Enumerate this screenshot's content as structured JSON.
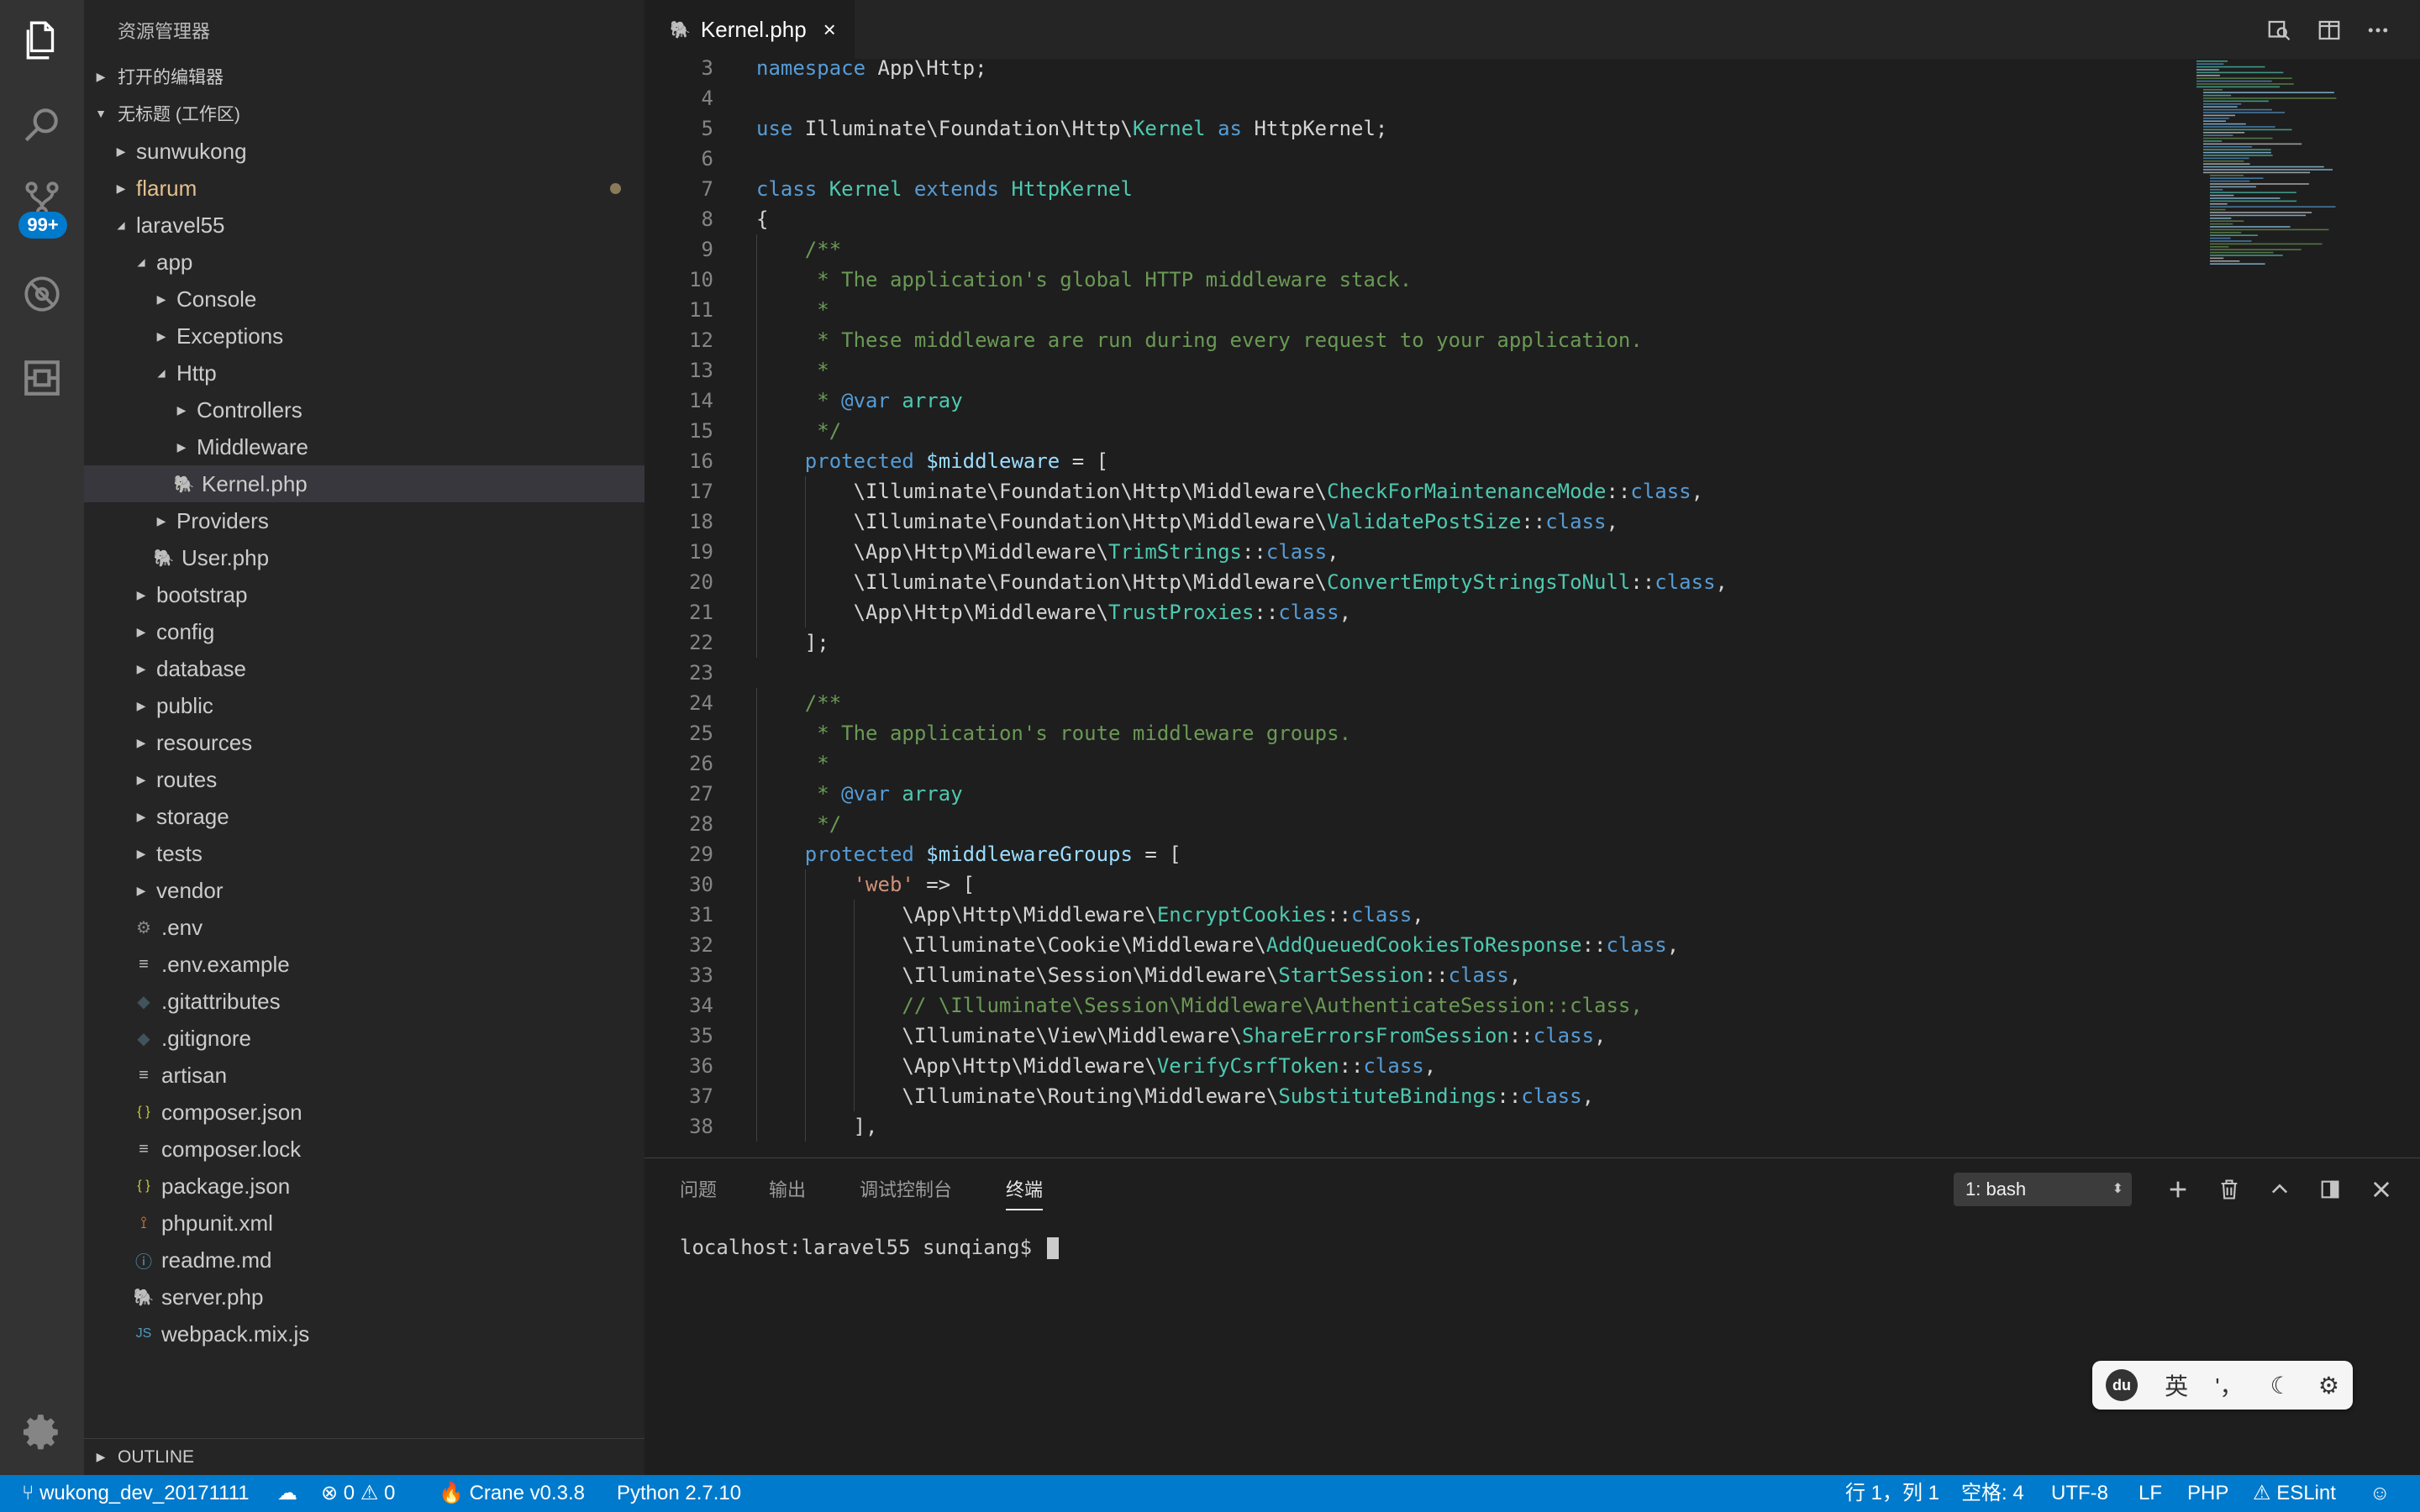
{
  "sidebar": {
    "title": "资源管理器",
    "open_editors": "打开的编辑器",
    "workspace": "无标题 (工作区)",
    "outline": "OUTLINE",
    "source_control_badge": "99+",
    "tree": [
      {
        "label": "sunwukong",
        "type": "folder",
        "level": 1,
        "expanded": false
      },
      {
        "label": "flarum",
        "type": "folder",
        "level": 1,
        "expanded": false,
        "modified": true
      },
      {
        "label": "laravel55",
        "type": "folder",
        "level": 1,
        "expanded": true
      },
      {
        "label": "app",
        "type": "folder",
        "level": 2,
        "expanded": true
      },
      {
        "label": "Console",
        "type": "folder",
        "level": 3,
        "expanded": false
      },
      {
        "label": "Exceptions",
        "type": "folder",
        "level": 3,
        "expanded": false
      },
      {
        "label": "Http",
        "type": "folder",
        "level": 3,
        "expanded": true
      },
      {
        "label": "Controllers",
        "type": "folder",
        "level": 4,
        "expanded": false
      },
      {
        "label": "Middleware",
        "type": "folder",
        "level": 4,
        "expanded": false
      },
      {
        "label": "Kernel.php",
        "type": "php",
        "level": 4,
        "selected": true
      },
      {
        "label": "Providers",
        "type": "folder",
        "level": 3,
        "expanded": false
      },
      {
        "label": "User.php",
        "type": "php",
        "level": 3
      },
      {
        "label": "bootstrap",
        "type": "folder",
        "level": 2,
        "expanded": false
      },
      {
        "label": "config",
        "type": "folder",
        "level": 2,
        "expanded": false
      },
      {
        "label": "database",
        "type": "folder",
        "level": 2,
        "expanded": false
      },
      {
        "label": "public",
        "type": "folder",
        "level": 2,
        "expanded": false
      },
      {
        "label": "resources",
        "type": "folder",
        "level": 2,
        "expanded": false
      },
      {
        "label": "routes",
        "type": "folder",
        "level": 2,
        "expanded": false
      },
      {
        "label": "storage",
        "type": "folder",
        "level": 2,
        "expanded": false
      },
      {
        "label": "tests",
        "type": "folder",
        "level": 2,
        "expanded": false
      },
      {
        "label": "vendor",
        "type": "folder",
        "level": 2,
        "expanded": false
      },
      {
        "label": ".env",
        "type": "gear",
        "level": 2
      },
      {
        "label": ".env.example",
        "type": "lines",
        "level": 2
      },
      {
        "label": ".gitattributes",
        "type": "git",
        "level": 2
      },
      {
        "label": ".gitignore",
        "type": "git",
        "level": 2
      },
      {
        "label": "artisan",
        "type": "lines",
        "level": 2
      },
      {
        "label": "composer.json",
        "type": "json",
        "level": 2
      },
      {
        "label": "composer.lock",
        "type": "lines",
        "level": 2
      },
      {
        "label": "package.json",
        "type": "json",
        "level": 2
      },
      {
        "label": "phpunit.xml",
        "type": "rss",
        "level": 2
      },
      {
        "label": "readme.md",
        "type": "info",
        "level": 2
      },
      {
        "label": "server.php",
        "type": "php",
        "level": 2
      },
      {
        "label": "webpack.mix.js",
        "type": "js",
        "level": 2
      }
    ]
  },
  "editor": {
    "tab_label": "Kernel.php",
    "lines": [
      {
        "n": "3",
        "indent": 0,
        "t": [
          [
            "namespace ",
            "kw"
          ],
          [
            "App\\Http;",
            "t"
          ]
        ]
      },
      {
        "n": "4",
        "indent": 0,
        "t": []
      },
      {
        "n": "5",
        "indent": 0,
        "t": [
          [
            "use ",
            "kw"
          ],
          [
            "Illuminate\\Foundation\\Http\\",
            "t"
          ],
          [
            "Kernel",
            "cls"
          ],
          [
            " as ",
            "kw"
          ],
          [
            "HttpKernel;",
            "t"
          ]
        ]
      },
      {
        "n": "6",
        "indent": 0,
        "t": []
      },
      {
        "n": "7",
        "indent": 0,
        "t": [
          [
            "class ",
            "kw"
          ],
          [
            "Kernel ",
            "cls"
          ],
          [
            "extends ",
            "kw"
          ],
          [
            "HttpKernel",
            "cls"
          ]
        ]
      },
      {
        "n": "8",
        "indent": 0,
        "t": [
          [
            "{",
            "t"
          ]
        ]
      },
      {
        "n": "9",
        "indent": 1,
        "t": [
          [
            "/**",
            "cm"
          ]
        ]
      },
      {
        "n": "10",
        "indent": 1,
        "t": [
          [
            " * The application's global HTTP middleware stack.",
            "cm"
          ]
        ]
      },
      {
        "n": "11",
        "indent": 1,
        "t": [
          [
            " *",
            "cm"
          ]
        ]
      },
      {
        "n": "12",
        "indent": 1,
        "t": [
          [
            " * These middleware are run during every request to your application.",
            "cm"
          ]
        ]
      },
      {
        "n": "13",
        "indent": 1,
        "t": [
          [
            " *",
            "cm"
          ]
        ]
      },
      {
        "n": "14",
        "indent": 1,
        "t": [
          [
            " * ",
            "cm"
          ],
          [
            "@var",
            "kw"
          ],
          [
            " array",
            "cls"
          ]
        ]
      },
      {
        "n": "15",
        "indent": 1,
        "t": [
          [
            " */",
            "cm"
          ]
        ]
      },
      {
        "n": "16",
        "indent": 1,
        "t": [
          [
            "protected ",
            "kw"
          ],
          [
            "$middleware",
            "var"
          ],
          [
            " = [",
            "t"
          ]
        ]
      },
      {
        "n": "17",
        "indent": 2,
        "t": [
          [
            "\\Illuminate\\Foundation\\Http\\Middleware\\",
            "t"
          ],
          [
            "CheckForMaintenanceMode",
            "cls"
          ],
          [
            "::",
            "t"
          ],
          [
            "class",
            "kw"
          ],
          [
            ",",
            "t"
          ]
        ]
      },
      {
        "n": "18",
        "indent": 2,
        "t": [
          [
            "\\Illuminate\\Foundation\\Http\\Middleware\\",
            "t"
          ],
          [
            "ValidatePostSize",
            "cls"
          ],
          [
            "::",
            "t"
          ],
          [
            "class",
            "kw"
          ],
          [
            ",",
            "t"
          ]
        ]
      },
      {
        "n": "19",
        "indent": 2,
        "t": [
          [
            "\\App\\Http\\Middleware\\",
            "t"
          ],
          [
            "TrimStrings",
            "cls"
          ],
          [
            "::",
            "t"
          ],
          [
            "class",
            "kw"
          ],
          [
            ",",
            "t"
          ]
        ]
      },
      {
        "n": "20",
        "indent": 2,
        "t": [
          [
            "\\Illuminate\\Foundation\\Http\\Middleware\\",
            "t"
          ],
          [
            "ConvertEmptyStringsToNull",
            "cls"
          ],
          [
            "::",
            "t"
          ],
          [
            "class",
            "kw"
          ],
          [
            ",",
            "t"
          ]
        ]
      },
      {
        "n": "21",
        "indent": 2,
        "t": [
          [
            "\\App\\Http\\Middleware\\",
            "t"
          ],
          [
            "TrustProxies",
            "cls"
          ],
          [
            "::",
            "t"
          ],
          [
            "class",
            "kw"
          ],
          [
            ",",
            "t"
          ]
        ]
      },
      {
        "n": "22",
        "indent": 1,
        "t": [
          [
            "];",
            "t"
          ]
        ]
      },
      {
        "n": "23",
        "indent": 0,
        "t": []
      },
      {
        "n": "24",
        "indent": 1,
        "t": [
          [
            "/**",
            "cm"
          ]
        ]
      },
      {
        "n": "25",
        "indent": 1,
        "t": [
          [
            " * The application's route middleware groups.",
            "cm"
          ]
        ]
      },
      {
        "n": "26",
        "indent": 1,
        "t": [
          [
            " *",
            "cm"
          ]
        ]
      },
      {
        "n": "27",
        "indent": 1,
        "t": [
          [
            " * ",
            "cm"
          ],
          [
            "@var",
            "kw"
          ],
          [
            " array",
            "cls"
          ]
        ]
      },
      {
        "n": "28",
        "indent": 1,
        "t": [
          [
            " */",
            "cm"
          ]
        ]
      },
      {
        "n": "29",
        "indent": 1,
        "t": [
          [
            "protected ",
            "kw"
          ],
          [
            "$middlewareGroups",
            "var"
          ],
          [
            " = [",
            "t"
          ]
        ]
      },
      {
        "n": "30",
        "indent": 2,
        "t": [
          [
            "'web'",
            "str"
          ],
          [
            " => [",
            "t"
          ]
        ]
      },
      {
        "n": "31",
        "indent": 3,
        "t": [
          [
            "\\App\\Http\\Middleware\\",
            "t"
          ],
          [
            "EncryptCookies",
            "cls"
          ],
          [
            "::",
            "t"
          ],
          [
            "class",
            "kw"
          ],
          [
            ",",
            "t"
          ]
        ]
      },
      {
        "n": "32",
        "indent": 3,
        "t": [
          [
            "\\Illuminate\\Cookie\\Middleware\\",
            "t"
          ],
          [
            "AddQueuedCookiesToResponse",
            "cls"
          ],
          [
            "::",
            "t"
          ],
          [
            "class",
            "kw"
          ],
          [
            ",",
            "t"
          ]
        ]
      },
      {
        "n": "33",
        "indent": 3,
        "t": [
          [
            "\\Illuminate\\Session\\Middleware\\",
            "t"
          ],
          [
            "StartSession",
            "cls"
          ],
          [
            "::",
            "t"
          ],
          [
            "class",
            "kw"
          ],
          [
            ",",
            "t"
          ]
        ]
      },
      {
        "n": "34",
        "indent": 3,
        "t": [
          [
            "// \\Illuminate\\Session\\Middleware\\AuthenticateSession::class,",
            "cm"
          ]
        ]
      },
      {
        "n": "35",
        "indent": 3,
        "t": [
          [
            "\\Illuminate\\View\\Middleware\\",
            "t"
          ],
          [
            "ShareErrorsFromSession",
            "cls"
          ],
          [
            "::",
            "t"
          ],
          [
            "class",
            "kw"
          ],
          [
            ",",
            "t"
          ]
        ]
      },
      {
        "n": "36",
        "indent": 3,
        "t": [
          [
            "\\App\\Http\\Middleware\\",
            "t"
          ],
          [
            "VerifyCsrfToken",
            "cls"
          ],
          [
            "::",
            "t"
          ],
          [
            "class",
            "kw"
          ],
          [
            ",",
            "t"
          ]
        ]
      },
      {
        "n": "37",
        "indent": 3,
        "t": [
          [
            "\\Illuminate\\Routing\\Middleware\\",
            "t"
          ],
          [
            "SubstituteBindings",
            "cls"
          ],
          [
            "::",
            "t"
          ],
          [
            "class",
            "kw"
          ],
          [
            ",",
            "t"
          ]
        ]
      },
      {
        "n": "38",
        "indent": 2,
        "t": [
          [
            "],",
            "t"
          ]
        ]
      }
    ]
  },
  "syntax_colors": {
    "kw": "#569cd6",
    "cls": "#4ec9b0",
    "t": "#d4d4d4",
    "cm": "#6a9955",
    "var": "#9cdcfe",
    "str": "#ce9178"
  },
  "panel": {
    "tabs": [
      "问题",
      "输出",
      "调试控制台",
      "终端"
    ],
    "active_tab": "终端",
    "terminal_select": "1: bash",
    "terminal_prompt": "localhost:laravel55 sunqiang$ "
  },
  "ime": {
    "logo": "du",
    "lang": "英",
    "punct": "'，",
    "moon": "☾",
    "gear": "⚙"
  },
  "statusbar": {
    "branch": "wukong_dev_20171111",
    "errors": "0",
    "warnings": "0",
    "crane": "Crane v0.3.8",
    "python": "Python 2.7.10",
    "position": "行 1，列 1",
    "spaces": "空格: 4",
    "encoding": "UTF-8",
    "eol": "LF",
    "language": "PHP",
    "eslint": "ESLint"
  }
}
